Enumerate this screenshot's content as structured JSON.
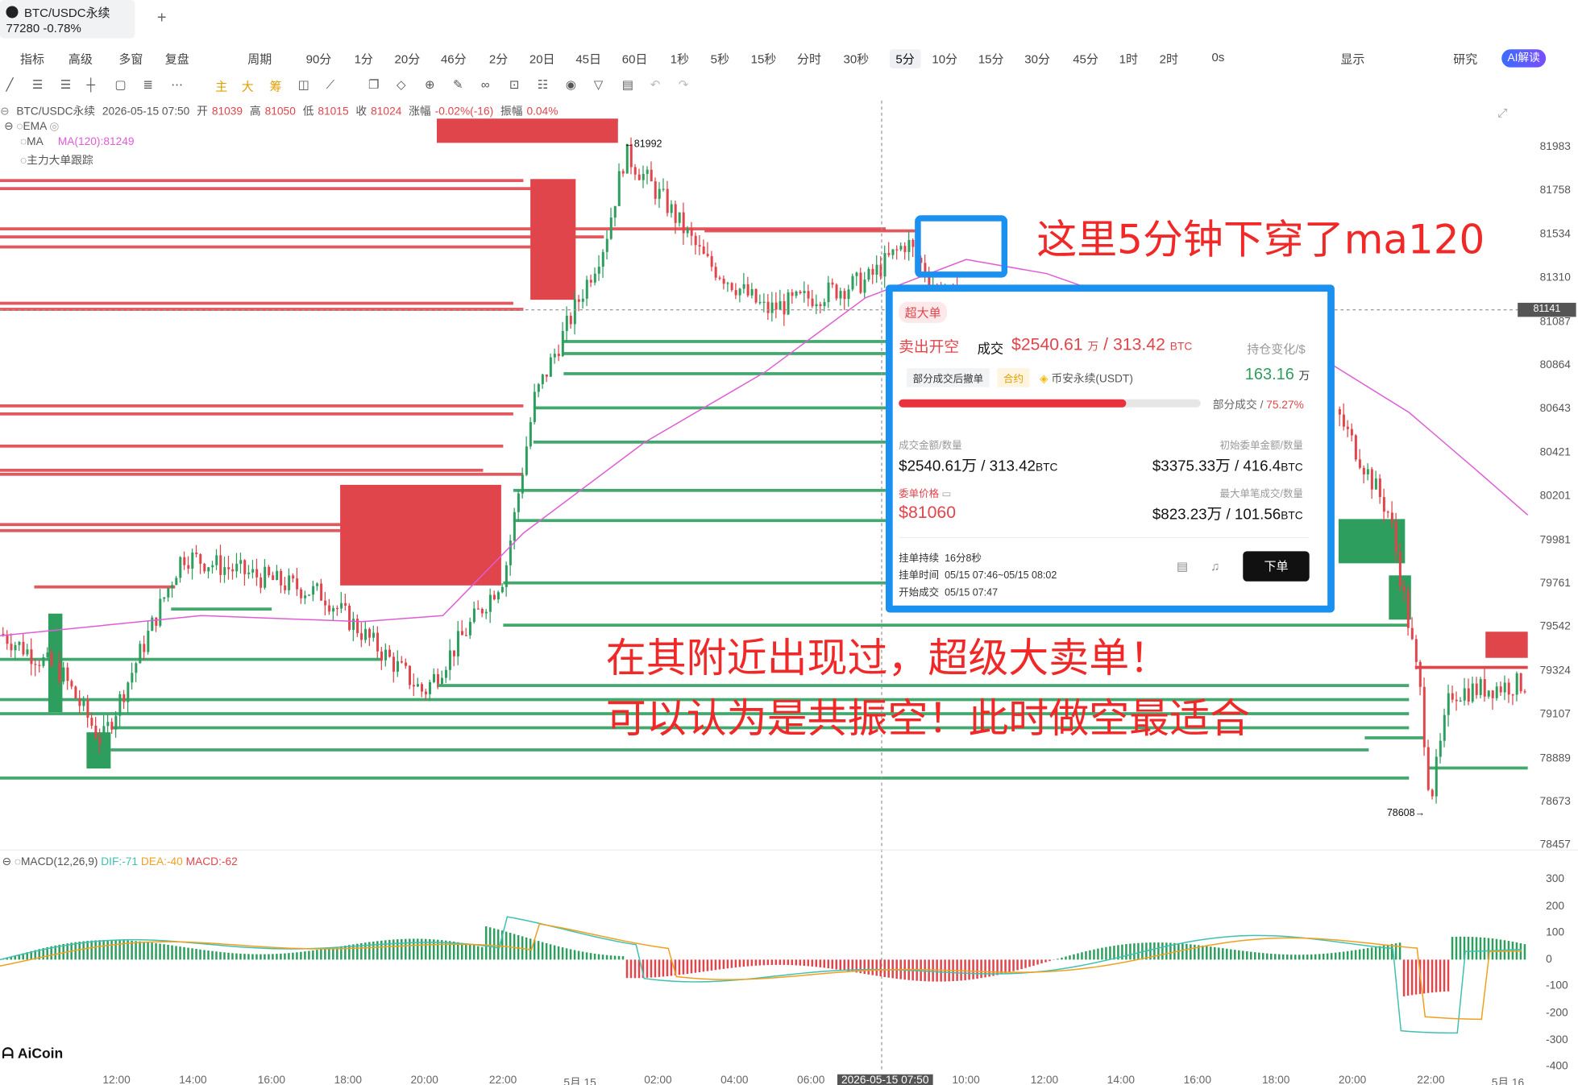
{
  "tab": {
    "pair": "BTC/USDC永续",
    "price": "77280",
    "change": "-0.78%"
  },
  "toolbar": {
    "items": [
      "指标",
      "高级",
      "多窗",
      "复盘",
      "周期",
      "90分",
      "1分",
      "20分",
      "46分",
      "2分",
      "20日",
      "45日",
      "60日",
      "1秒",
      "5秒",
      "15秒",
      "分时",
      "30秒",
      "5分",
      "10分",
      "15分",
      "30分",
      "45分",
      "1时",
      "2时",
      "0s",
      "显示",
      "研究"
    ],
    "active": "5分",
    "ai": "AI解读"
  },
  "info": {
    "pair": "BTC/USDC永续",
    "datetime": "2026-05-15 07:50",
    "open_label": "开",
    "open": "81039",
    "high_label": "高",
    "high": "81050",
    "low_label": "低",
    "low": "81015",
    "close_label": "收",
    "close": "81024",
    "chg_label": "涨幅",
    "chg": "-0.02%(-16)",
    "amp_label": "振幅",
    "amp": "0.04%"
  },
  "indicators": {
    "ema": "EMA",
    "ma": "MA",
    "ma120": "MA(120):81249",
    "bigorder": "主力大单跟踪"
  },
  "macd": {
    "label": "MACD(12,26,9)",
    "dif": "DIF:-71",
    "dea": "DEA:-40",
    "macd": "MACD:-62"
  },
  "price_axis": [
    "81983",
    "81758",
    "81534",
    "81310",
    "81087",
    "80864",
    "80643",
    "80421",
    "80201",
    "79981",
    "79761",
    "79542",
    "79324",
    "79107",
    "78889",
    "78673",
    "78457"
  ],
  "macd_axis": [
    "300",
    "200",
    "100",
    "0",
    "-100",
    "-200",
    "-300",
    "-400"
  ],
  "crosshair_price": "81141",
  "time_axis": [
    "12:00",
    "14:00",
    "16:00",
    "18:00",
    "20:00",
    "22:00",
    "5月 15",
    "02:00",
    "04:00",
    "06:00",
    "2026-05-15 07:50",
    "10:00",
    "12:00",
    "14:00",
    "16:00",
    "18:00",
    "20:00",
    "22:00",
    "5月 16"
  ],
  "high_marker": "81992",
  "low_marker": "78608",
  "notes": {
    "top": "这里5分钟下穿了ma120",
    "line1": "在其附近出现过，超级大卖单！",
    "line2": "可以认为是共振空！此时做空最适合"
  },
  "popup": {
    "badge": "超大单",
    "action": "卖出开空",
    "deal_label": "成交",
    "deal_amount": "$2540.61",
    "deal_unit": "万",
    "deal_qty": "/ 313.42",
    "deal_qty_unit": "BTC",
    "pos_label": "持仓变化/$",
    "tag1": "部分成交后撤单",
    "tag2": "合约",
    "exchange": "币安永续(USDT)",
    "pos_value": "163.16",
    "pos_unit": "万",
    "partial_label": "部分成交",
    "partial_pct": "75.27%",
    "progress": 0.7527,
    "amt_label": "成交金额/数量",
    "amt_value": "$2540.61万 / 313.42",
    "amt_unit": "BTC",
    "init_label": "初始委单金额/数量",
    "init_value": "$3375.33万 / 416.4",
    "init_unit": "BTC",
    "price_label": "委单价格",
    "price_value": "$81060",
    "max_label": "最大单笔成交/数量",
    "max_value": "$823.23万 / 101.56",
    "max_unit": "BTC",
    "dur_label": "挂单持续",
    "dur_value": "16分8秒",
    "time_label": "挂单时间",
    "time_value": "05/15 07:46~05/15 08:02",
    "start_label": "开始成交",
    "start_value": "05/15 07:47",
    "order_btn": "下单"
  },
  "brand": "AiCoin",
  "colors": {
    "up": "#2e9e5e",
    "down": "#e0454c",
    "ma": "#e05cd6",
    "dif": "#40c0b0",
    "dea": "#f0a020",
    "highlight": "#1a90f0",
    "note": "#f02828"
  }
}
